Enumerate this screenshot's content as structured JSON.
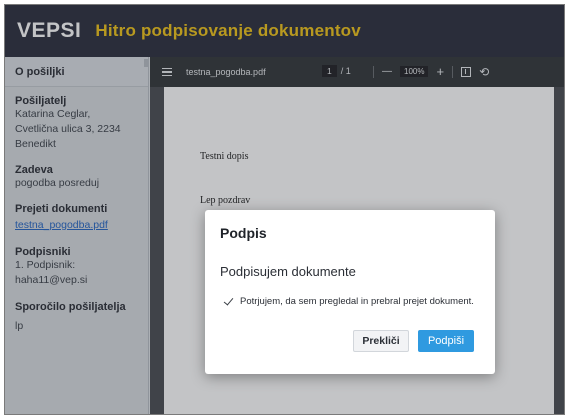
{
  "header": {
    "logo": "VEPSI",
    "tagline": "Hitro podpisovanje dokumentov"
  },
  "sidebar": {
    "title": "O pošiljki",
    "sender": {
      "label": "Pošiljatelj",
      "name": "Katarina Ceglar,",
      "street": "Cvetlična ulica 3, 2234",
      "city": "Benedikt"
    },
    "subject": {
      "label": "Zadeva",
      "value": "pogodba posreduj"
    },
    "received": {
      "label": "Prejeti dokumenti",
      "file": "testna_pogodba.pdf"
    },
    "signers": {
      "label": "Podpisniki",
      "first": "1. Podpisnik:",
      "email": "haha11@vep.si"
    },
    "message": {
      "label": "Sporočilo pošiljatelja",
      "value": "lp"
    }
  },
  "viewer": {
    "filename": "testna_pogodba.pdf",
    "page_current": "1",
    "page_total": "/ 1",
    "zoom_out": "—",
    "zoom": "100%",
    "zoom_in": "+",
    "icons": [
      "menu-icon",
      "fit-page-icon",
      "rotate-icon"
    ],
    "document": {
      "line1": "Testni dopis",
      "line2": "Lep pozdrav"
    }
  },
  "modal": {
    "title": "Podpis",
    "subtitle": "Podpisujem dokumente",
    "confirm": "Potrjujem, da sem pregledal in prebral prejet dokument.",
    "cancel": "Prekliči",
    "sign": "Podpiši"
  },
  "colors": {
    "header_bg": "#2c2f3d",
    "tagline": "#f0c419",
    "primary": "#2f9ae0",
    "link": "#2466c4"
  }
}
